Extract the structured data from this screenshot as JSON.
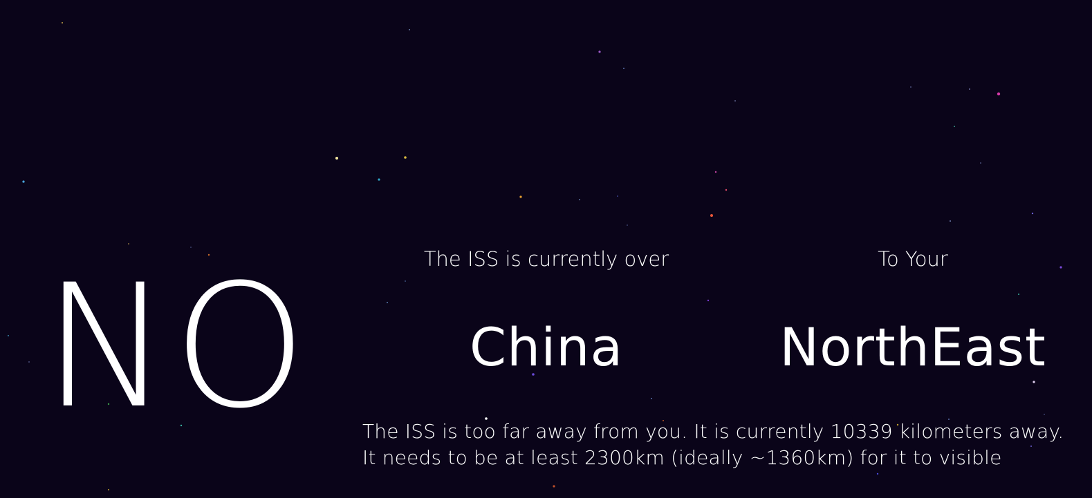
{
  "visibility_answer": "NO",
  "location": {
    "label": "The ISS is currently over",
    "value": "China"
  },
  "direction": {
    "label": "To Your",
    "value": "NorthEast"
  },
  "info": {
    "line1": "The ISS is too far away from you. It is currently 10339 kilometers away.",
    "line2": "It needs to be at least 2300km (ideally ~1360km) for it to visible"
  },
  "colors": {
    "background": "#0a0419",
    "text": "#ffffff"
  }
}
